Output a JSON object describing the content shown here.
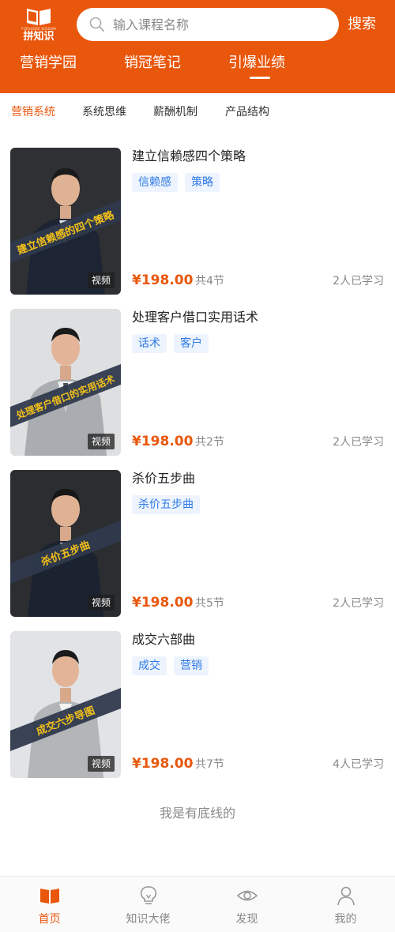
{
  "header": {
    "logo_tagline": "FORSHORE WISDOM",
    "logo_name": "拼知识",
    "search_placeholder": "输入课程名称",
    "search_button": "搜索",
    "tabs": [
      {
        "label": "营销学园"
      },
      {
        "label": "销冠笔记"
      },
      {
        "label": "引爆业绩",
        "active": true
      }
    ]
  },
  "sub_tabs": [
    {
      "label": "营销系统",
      "active": true
    },
    {
      "label": "系统思维"
    },
    {
      "label": "薪酬机制"
    },
    {
      "label": "产品结构"
    }
  ],
  "courses": [
    {
      "title": "建立信赖感四个策略",
      "tags": [
        "信赖感",
        "策略"
      ],
      "banner_text": "建立信赖感的四个策略",
      "video_tag": "视频",
      "price": "¥198.00",
      "lessons": "共4节",
      "learners": "2人已学习"
    },
    {
      "title": "处理客户借口实用话术",
      "tags": [
        "话术",
        "客户"
      ],
      "banner_text": "处理客户借口的实用话术",
      "video_tag": "视频",
      "price": "¥198.00",
      "lessons": "共2节",
      "learners": "2人已学习"
    },
    {
      "title": "杀价五步曲",
      "tags": [
        "杀价五步曲"
      ],
      "banner_text": "杀价五步曲",
      "video_tag": "视频",
      "price": "¥198.00",
      "lessons": "共5节",
      "learners": "2人已学习"
    },
    {
      "title": "成交六部曲",
      "tags": [
        "成交",
        "营销"
      ],
      "banner_text": "成交六步导图",
      "video_tag": "视频",
      "price": "¥198.00",
      "lessons": "共7节",
      "learners": "4人已学习"
    }
  ],
  "bottom_line_text": "我是有底线的",
  "bottom_nav": [
    {
      "label": "首页",
      "icon": "book-icon",
      "active": true
    },
    {
      "label": "知识大佬",
      "icon": "lightbulb-icon"
    },
    {
      "label": "发现",
      "icon": "eye-icon"
    },
    {
      "label": "我的",
      "icon": "user-icon"
    }
  ],
  "colors": {
    "brand": "#e9570c",
    "tag_text": "#2e7ae6",
    "tag_bg": "#eef4fd",
    "muted": "#888888"
  }
}
